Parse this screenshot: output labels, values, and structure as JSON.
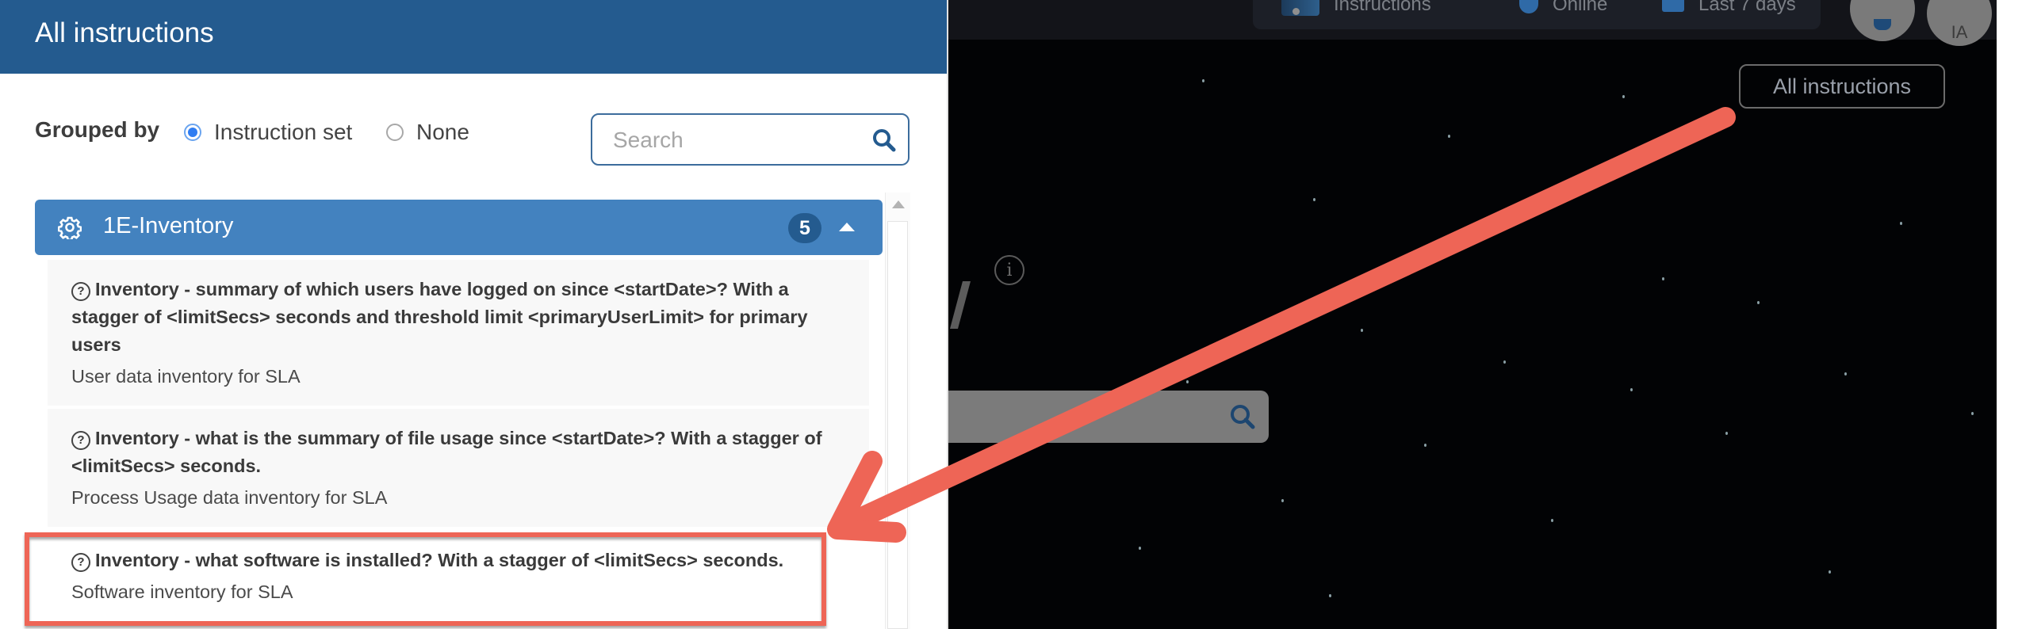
{
  "panel": {
    "title": "All instructions",
    "grouped_by_label": "Grouped by",
    "group_options": [
      {
        "label": "Instruction set",
        "selected": true
      },
      {
        "label": "None",
        "selected": false
      }
    ],
    "search": {
      "placeholder": "Search",
      "value": ""
    },
    "groups": [
      {
        "name": "1E-Inventory",
        "count": "5",
        "expanded": true,
        "items": [
          {
            "question": "Inventory - summary of which users have logged on since <startDate>? With a stagger of <limitSecs> seconds and threshold limit <primaryUserLimit> for primary users",
            "description": "User data inventory for SLA"
          },
          {
            "question": "Inventory - what is the summary of file usage since <startDate>? With a stagger of <limitSecs> seconds.",
            "description": "Process Usage data inventory for SLA"
          },
          {
            "question": "Inventory - what software is installed? With a stagger of <limitSecs> seconds.",
            "description": "Software inventory for SLA",
            "highlighted": true
          }
        ]
      }
    ]
  },
  "topbar": {
    "items": [
      {
        "label": "Instructions",
        "icon": "instructions-icon"
      },
      {
        "label": "Online",
        "icon": "online-icon"
      },
      {
        "label": "Last 7 days",
        "icon": "calendar-icon"
      }
    ],
    "avatars": [
      {
        "label": "",
        "icon": "notification-icon"
      },
      {
        "label": "IA"
      }
    ]
  },
  "background": {
    "all_instructions_button": "All instructions",
    "info_icon": "i"
  },
  "annotation": {
    "color": "#ee6556",
    "arrow_from": "all-instructions-button",
    "arrow_to": "highlighted-item"
  },
  "colors": {
    "panel_header": "#245b8f",
    "group_header": "#4382bf",
    "badge": "#245b8f",
    "radio_selected": "#2f7df2",
    "annotation": "#ee6556"
  }
}
